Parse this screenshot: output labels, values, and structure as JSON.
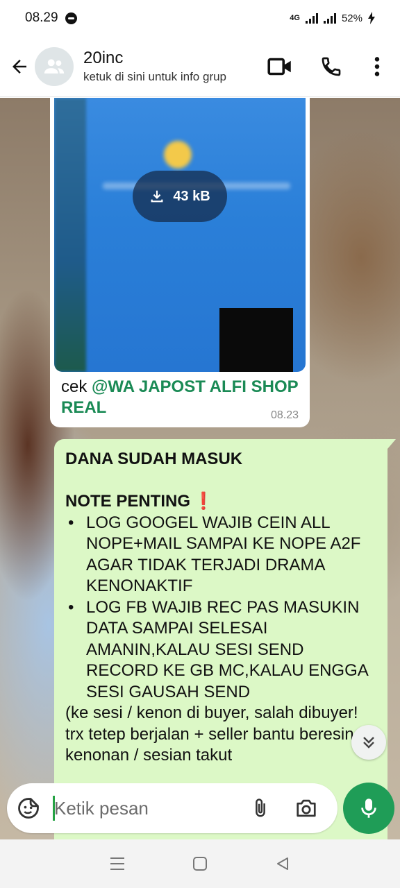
{
  "status_bar": {
    "time": "08.29",
    "network": "4G",
    "battery": "52%"
  },
  "header": {
    "title": "20inc",
    "subtitle": "ketuk di sini untuk info grup"
  },
  "messages": {
    "incoming": {
      "download_size": "43 kB",
      "caption_prefix": "cek ",
      "mention": "@WA JAPOST ALFI SHOP",
      "caption_line2": "REAL",
      "time": "08.23"
    },
    "outgoing": {
      "line1": "DANA SUDAH MASUK",
      "note_title": "NOTE PENTING",
      "note_icon": "❗",
      "bullet1": "LOG GOOGEL WAJIB CEIN ALL NOPE+MAIL SAMPAI KE NOPE A2F AGAR TIDAK TERJADI DRAMA KENONAKTIF",
      "bullet2": "LOG FB WAJIB REC PAS MASUKIN DATA SAMPAI SELESAI AMANIN,KALAU SESI SEND RECORD KE GB MC,KALAU ENGGA SESI GAUSAH SEND",
      "tail": "(ke sesi / kenon di buyer, salah dibuyer! trx tetep berjalan + seller bantu beresin kenonan / sesian takut"
    }
  },
  "composer": {
    "placeholder": "Ketik pesan"
  },
  "colors": {
    "accent_green": "#1f9d57",
    "outgoing_bubble": "#dcf8c6",
    "mention_green": "#1a8a55",
    "exclaim_red": "#e2202a"
  }
}
